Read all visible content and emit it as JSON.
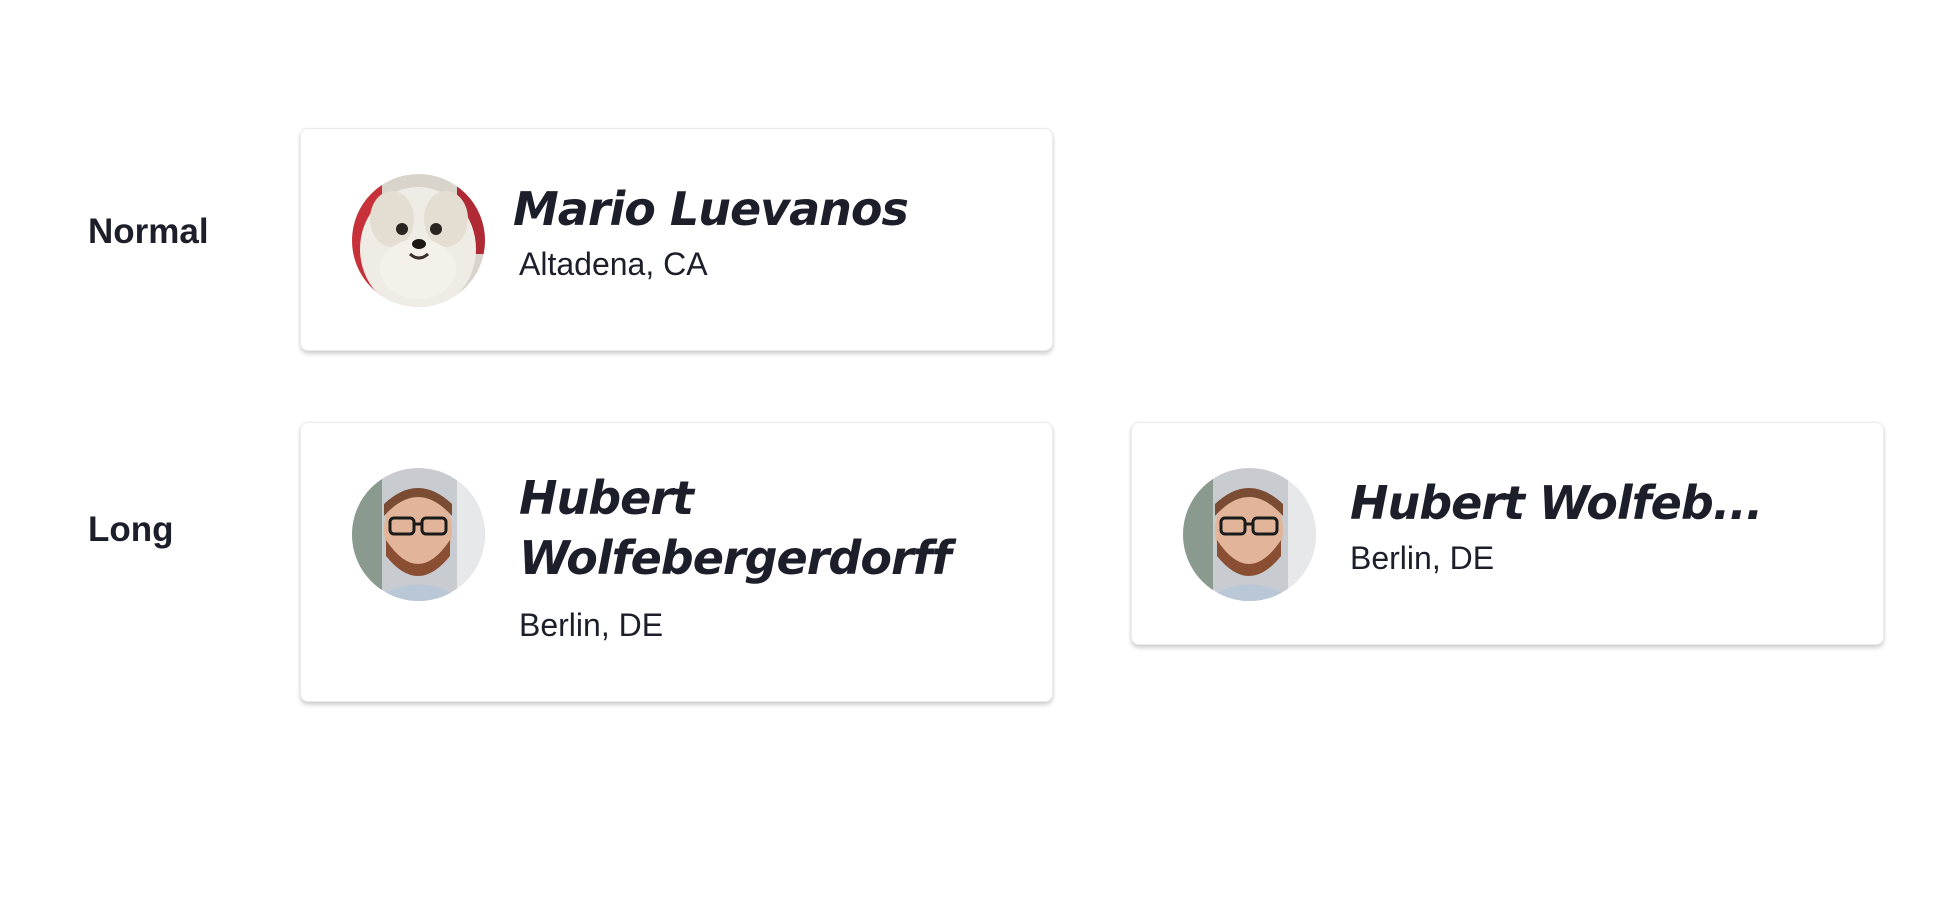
{
  "rows": {
    "normal_label": "Normal",
    "long_label": "Long"
  },
  "cards": {
    "normal": {
      "name": "Mario Luevanos",
      "location": "Altadena, CA",
      "avatar": "dog-photo"
    },
    "long_wrap": {
      "name": "Hubert Wolfebergerdorff",
      "location": "Berlin, DE",
      "avatar": "man-with-glasses-photo"
    },
    "long_truncated": {
      "name": "Hubert Wolfeb...",
      "location": "Berlin, DE",
      "avatar": "man-with-glasses-photo"
    }
  }
}
